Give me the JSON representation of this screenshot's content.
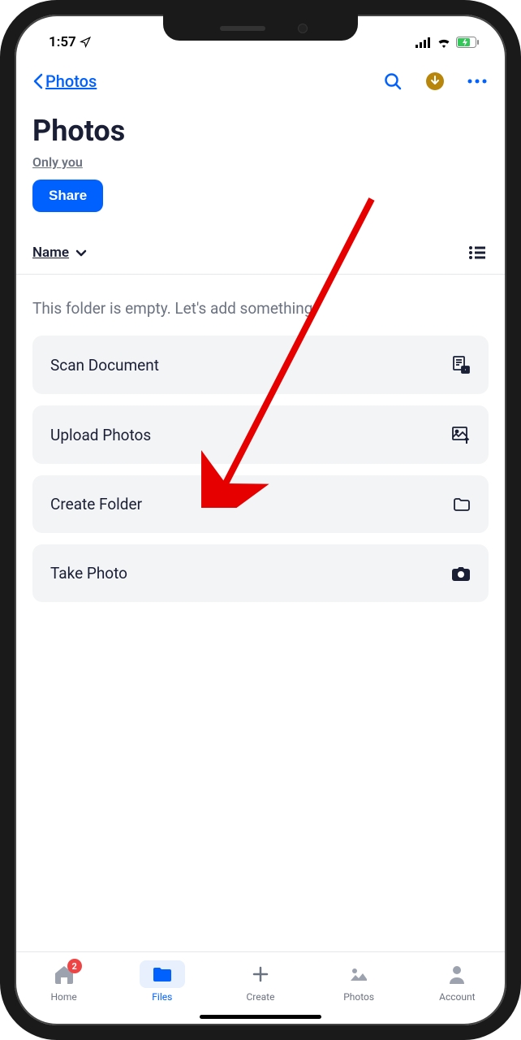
{
  "status": {
    "time": "1:57"
  },
  "nav": {
    "back_label": "Photos"
  },
  "page": {
    "title": "Photos",
    "share_status": "Only you",
    "share_button": "Share"
  },
  "sort": {
    "label": "Name"
  },
  "empty_message": "This folder is empty. Let's add something.",
  "actions": [
    {
      "label": "Scan Document",
      "icon": "scan-doc-icon"
    },
    {
      "label": "Upload Photos",
      "icon": "upload-photo-icon"
    },
    {
      "label": "Create Folder",
      "icon": "folder-icon"
    },
    {
      "label": "Take Photo",
      "icon": "camera-icon"
    }
  ],
  "tabs": [
    {
      "label": "Home",
      "badge": "2"
    },
    {
      "label": "Files"
    },
    {
      "label": "Create"
    },
    {
      "label": "Photos"
    },
    {
      "label": "Account"
    }
  ]
}
